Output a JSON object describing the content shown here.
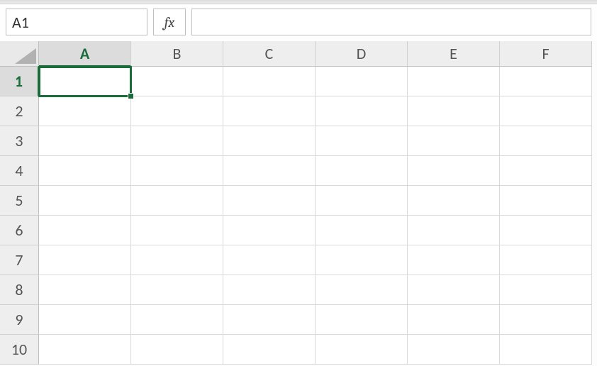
{
  "formula_bar": {
    "name_box_value": "A1",
    "fx_label": "fx",
    "formula_value": ""
  },
  "columns": [
    {
      "label": "A",
      "selected": true
    },
    {
      "label": "B",
      "selected": false
    },
    {
      "label": "C",
      "selected": false
    },
    {
      "label": "D",
      "selected": false
    },
    {
      "label": "E",
      "selected": false
    },
    {
      "label": "F",
      "selected": false
    }
  ],
  "rows": [
    {
      "label": "1",
      "selected": true
    },
    {
      "label": "2",
      "selected": false
    },
    {
      "label": "3",
      "selected": false
    },
    {
      "label": "4",
      "selected": false
    },
    {
      "label": "5",
      "selected": false
    },
    {
      "label": "6",
      "selected": false
    },
    {
      "label": "7",
      "selected": false
    },
    {
      "label": "8",
      "selected": false
    },
    {
      "label": "9",
      "selected": false
    },
    {
      "label": "10",
      "selected": false
    }
  ],
  "active_cell": {
    "col": 0,
    "row": 0
  },
  "cell_values": {}
}
